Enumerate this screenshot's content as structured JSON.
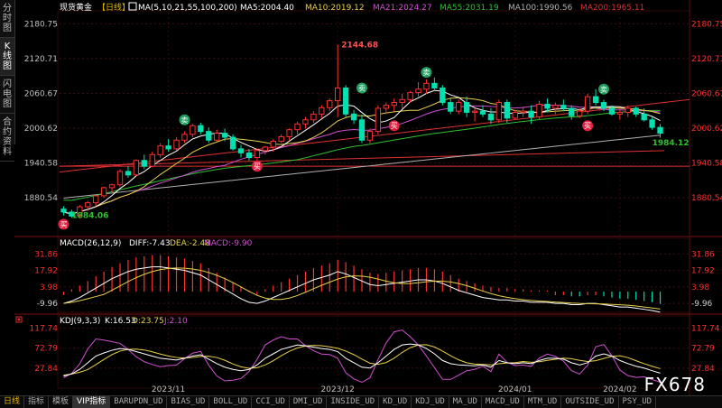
{
  "sidebar": {
    "tabs": [
      {
        "label": "分时图"
      },
      {
        "label": "K线图"
      },
      {
        "label": "闪电图"
      },
      {
        "label": "合约资料"
      }
    ],
    "active": 1
  },
  "header": {
    "symbol": "现货黄金",
    "period": "【日线】",
    "ma": [
      {
        "label": "MA(5,10,21,55,100,200)",
        "color": "#ffffff"
      },
      {
        "label": "MA5:2004.40",
        "color": "#ffffff"
      },
      {
        "label": "MA10:2019.12",
        "color": "#e8d04a"
      },
      {
        "label": "MA21:2024.27",
        "color": "#d050d0"
      },
      {
        "label": "MA55:2031.19",
        "color": "#30c030"
      },
      {
        "label": "MA100:1990.56",
        "color": "#b0b0b0"
      },
      {
        "label": "MA200:1965.11",
        "color": "#e03030"
      }
    ]
  },
  "macd_header": {
    "name": "MACD(26,12,9)",
    "diff": "DIFF:-7.43",
    "dea": "DEA:-2.48",
    "macd": "MACD:-9.90"
  },
  "kdj_header": {
    "name": "KDJ(9,3,3)",
    "k": "K:16.53",
    "d": "D:23.75",
    "j": "J:2.10"
  },
  "price_axis": {
    "labels": [
      "2180.75",
      "2120.71",
      "2060.67",
      "2000.62",
      "1940.58",
      "1880.54"
    ],
    "range": [
      1820,
      2200
    ]
  },
  "macd_axis": {
    "labels": [
      "31.86",
      "17.92",
      "3.98",
      "-9.96"
    ],
    "range": [
      -16,
      36
    ]
  },
  "kdj_axis": {
    "labels": [
      "117.74",
      "72.79",
      "27.84"
    ],
    "range": [
      -5,
      125
    ]
  },
  "x_axis": {
    "labels": [
      "2023/11",
      "2023/12",
      "2024/01",
      "2024/02"
    ]
  },
  "annotations": {
    "high": "2144.68",
    "low": "1884.06",
    "last": "1984.12",
    "sell": "卖",
    "buy": "买"
  },
  "colors": {
    "up": "#ff3030",
    "down": "#00e0b0",
    "bg": "#000000",
    "grid": "#3a1010"
  },
  "bottom_tabs": [
    "日线",
    "指标",
    "模板",
    "VIP指标",
    "BARUPDN_UD",
    "BIAS_UD",
    "BOLL_UD",
    "CCI_UD",
    "DMI_UD",
    "INSIDE_UD",
    "KD_UD",
    "KDJ_UD",
    "MA_UD",
    "MACD_UD",
    "MTM_UD",
    "OUTSIDE_UD",
    "PSY_UD"
  ],
  "watermark": "FX678",
  "chart_data": {
    "type": "candlestick",
    "title": "现货黄金【日线】",
    "candles": [
      [
        1861,
        1866,
        1850,
        1856
      ],
      [
        1856,
        1860,
        1846,
        1849
      ],
      [
        1850,
        1868,
        1845,
        1865
      ],
      [
        1865,
        1875,
        1858,
        1872
      ],
      [
        1872,
        1885,
        1866,
        1884
      ],
      [
        1884,
        1900,
        1880,
        1898
      ],
      [
        1898,
        1905,
        1890,
        1903
      ],
      [
        1903,
        1930,
        1900,
        1926
      ],
      [
        1926,
        1935,
        1915,
        1920
      ],
      [
        1920,
        1947,
        1918,
        1945
      ],
      [
        1945,
        1955,
        1930,
        1935
      ],
      [
        1935,
        1960,
        1933,
        1955
      ],
      [
        1955,
        1975,
        1950,
        1970
      ],
      [
        1970,
        1982,
        1960,
        1965
      ],
      [
        1965,
        1985,
        1962,
        1980
      ],
      [
        1980,
        1995,
        1975,
        1990
      ],
      [
        1990,
        2008,
        1985,
        2005
      ],
      [
        2005,
        2010,
        1990,
        1995
      ],
      [
        1995,
        2002,
        1975,
        1980
      ],
      [
        1980,
        1998,
        1978,
        1992
      ],
      [
        1992,
        2000,
        1978,
        1985
      ],
      [
        1985,
        1990,
        1962,
        1965
      ],
      [
        1965,
        1972,
        1950,
        1958
      ],
      [
        1958,
        1965,
        1945,
        1950
      ],
      [
        1950,
        1966,
        1945,
        1962
      ],
      [
        1962,
        1970,
        1955,
        1968
      ],
      [
        1968,
        1982,
        1960,
        1978
      ],
      [
        1978,
        1990,
        1975,
        1986
      ],
      [
        1986,
        2000,
        1980,
        1998
      ],
      [
        1998,
        2012,
        1990,
        2008
      ],
      [
        2008,
        2020,
        2000,
        2015
      ],
      [
        2015,
        2030,
        2010,
        2025
      ],
      [
        2025,
        2040,
        2018,
        2036
      ],
      [
        2036,
        2052,
        2030,
        2048
      ],
      [
        2048,
        2145,
        2020,
        2070
      ],
      [
        2070,
        2075,
        2020,
        2025
      ],
      [
        2025,
        2032,
        2008,
        2015
      ],
      [
        2015,
        2024,
        1975,
        1980
      ],
      [
        1980,
        2000,
        1975,
        1995
      ],
      [
        1995,
        2040,
        1990,
        2035
      ],
      [
        2035,
        2045,
        2025,
        2040
      ],
      [
        2040,
        2052,
        2030,
        2045
      ],
      [
        2045,
        2060,
        2035,
        2050
      ],
      [
        2050,
        2065,
        2045,
        2062
      ],
      [
        2062,
        2080,
        2055,
        2068
      ],
      [
        2068,
        2085,
        2060,
        2078
      ],
      [
        2078,
        2088,
        2065,
        2070
      ],
      [
        2070,
        2075,
        2040,
        2045
      ],
      [
        2045,
        2052,
        2025,
        2030
      ],
      [
        2030,
        2050,
        2025,
        2045
      ],
      [
        2045,
        2055,
        2020,
        2028
      ],
      [
        2028,
        2035,
        2012,
        2030
      ],
      [
        2030,
        2040,
        2020,
        2025
      ],
      [
        2025,
        2035,
        2008,
        2015
      ],
      [
        2015,
        2050,
        2010,
        2045
      ],
      [
        2045,
        2050,
        2010,
        2018
      ],
      [
        2018,
        2032,
        2015,
        2028
      ],
      [
        2028,
        2038,
        2020,
        2030
      ],
      [
        2030,
        2040,
        2008,
        2020
      ],
      [
        2020,
        2048,
        2015,
        2042
      ],
      [
        2042,
        2052,
        2028,
        2035
      ],
      [
        2035,
        2045,
        2025,
        2040
      ],
      [
        2040,
        2050,
        2030,
        2035
      ],
      [
        2035,
        2040,
        2015,
        2022
      ],
      [
        2022,
        2035,
        2018,
        2030
      ],
      [
        2030,
        2060,
        2025,
        2055
      ],
      [
        2055,
        2068,
        2040,
        2045
      ],
      [
        2045,
        2050,
        2030,
        2035
      ],
      [
        2035,
        2040,
        2022,
        2025
      ],
      [
        2025,
        2032,
        2015,
        2028
      ],
      [
        2028,
        2040,
        2020,
        2035
      ],
      [
        2035,
        2038,
        2020,
        2025
      ],
      [
        2025,
        2035,
        2012,
        2015
      ],
      [
        2015,
        2020,
        1998,
        2002
      ],
      [
        2002,
        2008,
        1984,
        1992
      ]
    ],
    "high": 2144.68,
    "low": 1884.06,
    "last": 1984.12
  }
}
